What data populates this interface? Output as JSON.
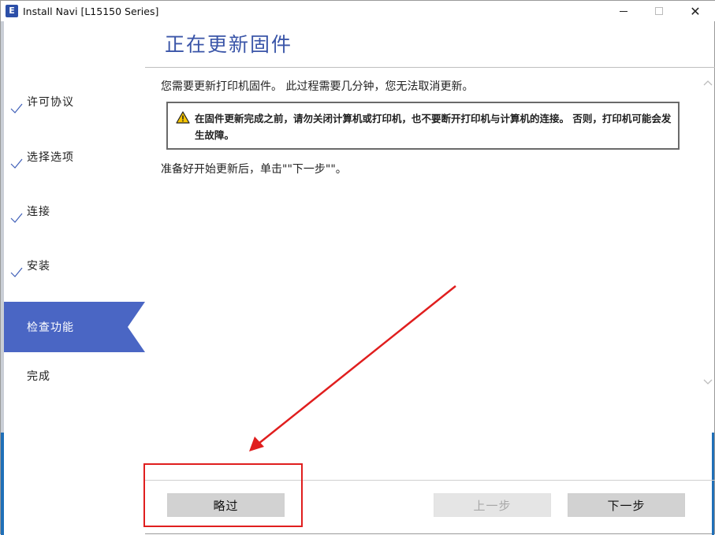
{
  "window": {
    "title": "Install Navi [L15150 Series]",
    "app_icon_letter": "E"
  },
  "sidebar": {
    "items": [
      {
        "label": "许可协议",
        "state": "done"
      },
      {
        "label": "选择选项",
        "state": "done"
      },
      {
        "label": "连接",
        "state": "done"
      },
      {
        "label": "安装",
        "state": "done"
      },
      {
        "label": "检查功能",
        "state": "active"
      },
      {
        "label": "完成",
        "state": "pending"
      }
    ]
  },
  "header": {
    "title": "正在更新固件"
  },
  "main": {
    "message": "您需要更新打印机固件。 此过程需要几分钟，您无法取消更新。",
    "warning": "在固件更新完成之前，请勿关闭计算机或打印机，也不要断开打印机与计算机的连接。 否则，打印机可能会发生故障。",
    "instruction": "准备好开始更新后，单击\"\"下一步\"\"。"
  },
  "footer": {
    "skip_label": "略过",
    "back_label": "上一步",
    "next_label": "下一步"
  },
  "colors": {
    "accent": "#4a66c4",
    "title_color": "#3a55a8",
    "annotation": "#e01e1e"
  }
}
